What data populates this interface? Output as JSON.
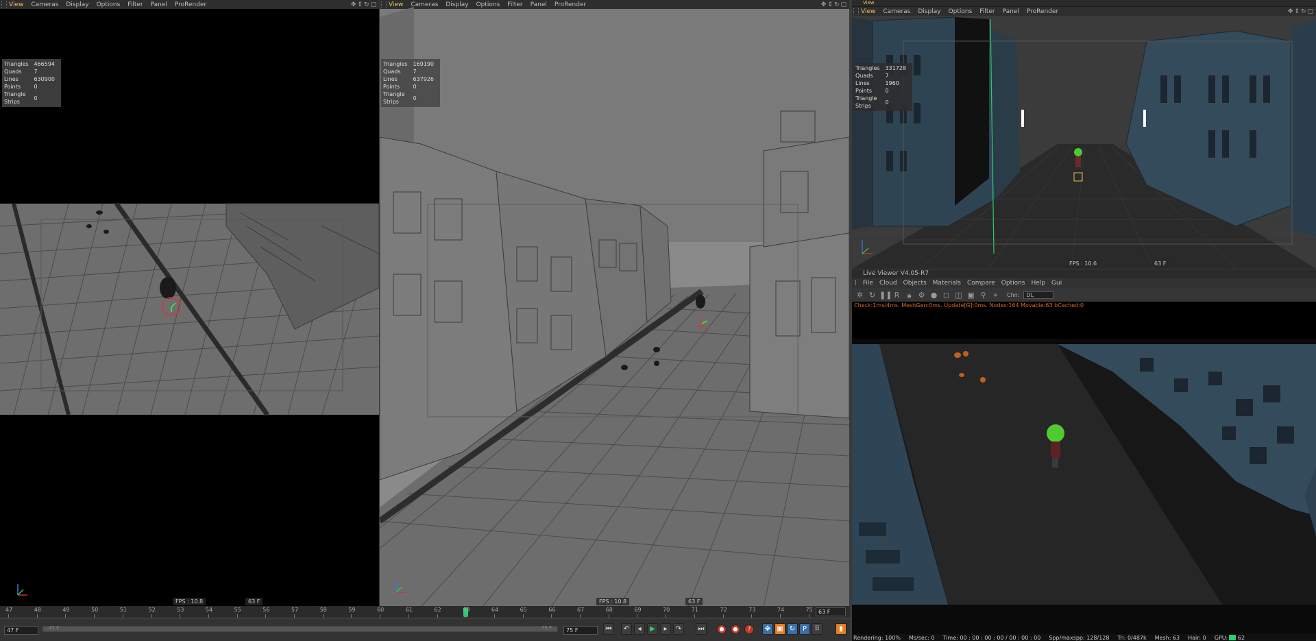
{
  "viewport_left": {
    "menu": [
      "View",
      "Cameras",
      "Display",
      "Options",
      "Filter",
      "Panel",
      "ProRender"
    ],
    "stats": [
      [
        "Triangles",
        "466594"
      ],
      [
        "Quads",
        "7"
      ],
      [
        "Lines",
        "630900"
      ],
      [
        "Points",
        "0"
      ],
      [
        "Triangle Strips",
        "0"
      ]
    ],
    "fps": "FPS : 10.8",
    "frame": "63 F"
  },
  "viewport_center": {
    "menu": [
      "View",
      "Cameras",
      "Display",
      "Options",
      "Filter",
      "Panel",
      "ProRender"
    ],
    "stats": [
      [
        "Triangles",
        "169190"
      ],
      [
        "Quads",
        "7"
      ],
      [
        "Lines",
        "637926"
      ],
      [
        "Points",
        "0"
      ],
      [
        "Triangle Strips",
        "0"
      ]
    ],
    "fps": "FPS : 10.8",
    "frame": "63 F"
  },
  "viewport_right": {
    "window_title": "View",
    "menu": [
      "View",
      "Cameras",
      "Display",
      "Options",
      "Filter",
      "Panel",
      "ProRender"
    ],
    "stats": [
      [
        "Triangles",
        "331728"
      ],
      [
        "Quads",
        "7"
      ],
      [
        "Lines",
        "1960"
      ],
      [
        "Points",
        "0"
      ],
      [
        "Triangle Strips",
        "0"
      ]
    ],
    "fps": "FPS : 10.6",
    "frame": "63 F"
  },
  "live_viewer": {
    "title": "Live Viewer V4.05-R7",
    "menu": [
      "File",
      "Cloud",
      "Objects",
      "Materials",
      "Compare",
      "Options",
      "Help",
      "Gui"
    ],
    "channel_label": "Chn:",
    "channel_value": "DL",
    "status": "Check:1ms/4ms. MeshGen:0ms. Update[G]:0ms. Nodes:164 Movable:63 bCached:0",
    "bottom": {
      "rendering": "Rendering: 100%",
      "mssec": "Ms/sec: 0",
      "time": "Time: 00 : 00 : 00 : 00 / 00 : 00 : 00",
      "spp": "Spp/maxspp: 128/128",
      "tri": "Tri: 0/487k",
      "mesh": "Mesh: 63",
      "hair": "Hair: 0",
      "gpu": "GPU:",
      "gpu_val": "62"
    }
  },
  "timeline": {
    "ticks": [
      "47",
      "48",
      "49",
      "50",
      "51",
      "52",
      "53",
      "54",
      "55",
      "56",
      "57",
      "58",
      "59",
      "60",
      "61",
      "62",
      "63",
      "64",
      "65",
      "66",
      "67",
      "68",
      "69",
      "70",
      "71",
      "72",
      "73",
      "74",
      "75"
    ],
    "current_frame": 63,
    "frame_field": "63 F",
    "start_field": "47 F",
    "range_left": "47 F",
    "range_right": "75 F",
    "end_field": "75 F"
  },
  "colors": {
    "active_menu": "#f0c060",
    "playhead": "#2ecc71",
    "status_text": "#d46a1e"
  }
}
